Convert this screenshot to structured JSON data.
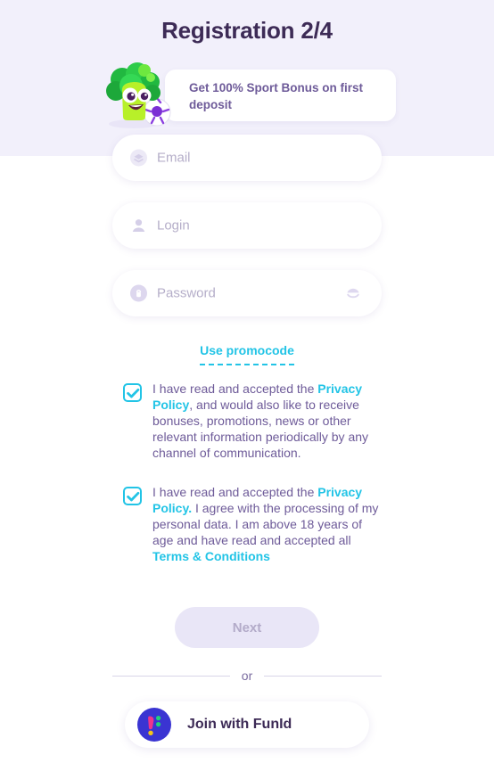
{
  "header": {
    "title": "Registration 2/4",
    "band_color": "#f2f0fb",
    "title_color": "#3d2b56"
  },
  "bonus": {
    "text": "Get 100% Sport Bonus on first deposit",
    "mascot_icon": "broccoli-mascot-with-soccer-ball"
  },
  "form": {
    "fields": [
      {
        "name": "email",
        "placeholder": "Email",
        "value": "",
        "icon": "envelope-icon"
      },
      {
        "name": "login",
        "placeholder": "Login",
        "value": "",
        "icon": "user-icon"
      },
      {
        "name": "password",
        "placeholder": "Password",
        "value": "",
        "icon": "lock-icon",
        "toggle_icon": "eye-hidden-icon"
      }
    ],
    "promocode_label": "Use promocode"
  },
  "consents": [
    {
      "checked": true,
      "pre": "I have read and accepted the ",
      "link1": "Privacy Policy",
      "post": ", and would also like to receive bonuses, promotions, news or other relevant information periodically by any channel of communication."
    },
    {
      "checked": true,
      "pre": "I have read and accepted the ",
      "link1": "Privacy Policy.",
      "mid": " I agree with the processing of my personal data. I am above 18 years of age and have read and accepted all ",
      "link2": "Terms & Conditions"
    }
  ],
  "actions": {
    "next_label": "Next",
    "next_disabled": true,
    "or_label": "or",
    "funid_label": "Join with FunId",
    "funid_logo_icon": "funid-logo-icon"
  },
  "colors": {
    "accent_cyan": "#22c4e6",
    "text_purple": "#6e5b99",
    "title_purple": "#3d2b56",
    "disabled_button_bg": "#e9e6f7",
    "funid_blue": "#3a34d2"
  }
}
